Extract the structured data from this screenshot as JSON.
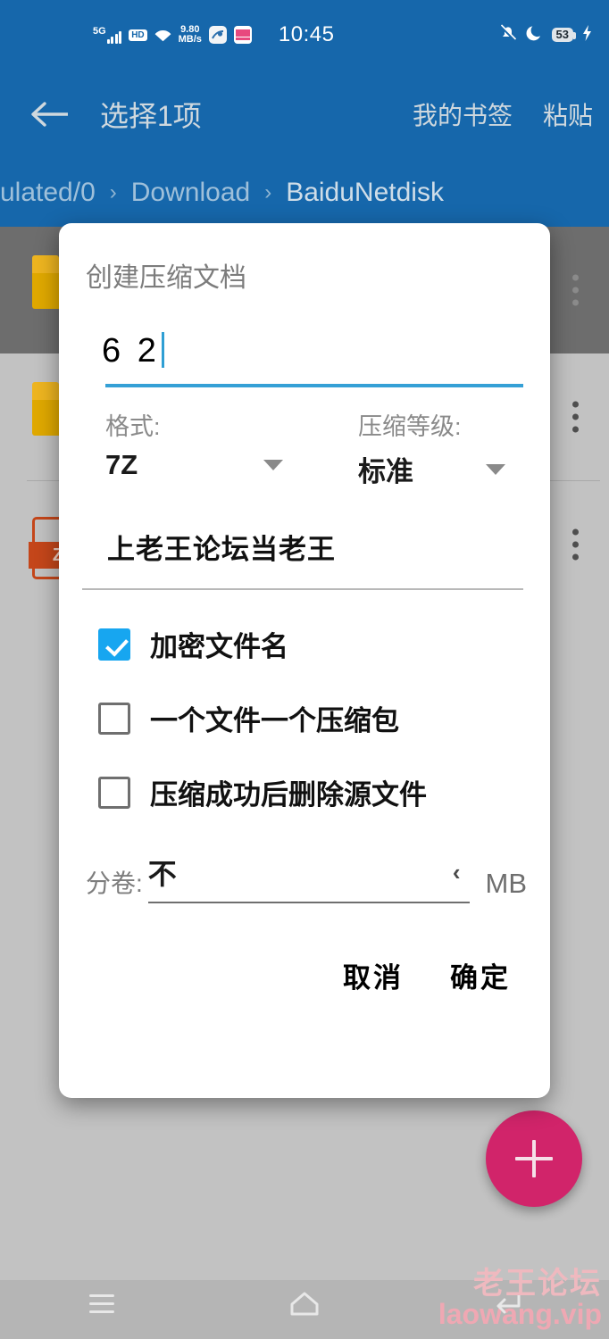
{
  "statusbar": {
    "network_type": "5G",
    "hd_label": "HD",
    "speed_value": "9.80",
    "speed_unit": "MB/s",
    "time": "10:45",
    "battery_level": "53",
    "icons": [
      "signal-icon",
      "hd-icon",
      "wifi-icon",
      "network-speed",
      "app-icon-1",
      "app-icon-2",
      "mute-icon",
      "dnd-moon-icon",
      "battery-icon",
      "charging-bolt-icon"
    ]
  },
  "appbar": {
    "back_icon": "back-arrow-icon",
    "title": "选择1项",
    "action_bookmarks": "我的书签",
    "action_paste": "粘贴"
  },
  "breadcrumb": {
    "items": [
      "ulated/0",
      "Download",
      "BaiduNetdisk"
    ],
    "separator": "›"
  },
  "filelist": {
    "rows": [
      {
        "icon": "folder-icon",
        "selected": true
      },
      {
        "icon": "folder-icon",
        "selected": false
      },
      {
        "icon": "zip-file-icon",
        "icon_label": "Z",
        "selected": false
      }
    ]
  },
  "dialog": {
    "title": "创建压缩文档",
    "name_value": "6 2",
    "format_label": "格式:",
    "format_value": "7Z",
    "level_label": "压缩等级:",
    "level_value": "标准",
    "password_value": "上老王论坛当老王",
    "checkboxes": [
      {
        "label": "加密文件名",
        "checked": true
      },
      {
        "label": "一个文件一个压缩包",
        "checked": false
      },
      {
        "label": "压缩成功后删除源文件",
        "checked": false
      }
    ],
    "split_label": "分卷:",
    "split_value": "不",
    "split_chevron": "‹",
    "split_unit": "MB",
    "cancel_label": "取消",
    "confirm_label": "确定"
  },
  "fab": {
    "icon": "plus-icon"
  },
  "watermark": {
    "line1": "老王论坛",
    "line2": "laowang.vip"
  },
  "navbar": {
    "menu_icon": "menu-icon",
    "home_icon": "home-icon",
    "back_icon": "back-nav-icon"
  },
  "colors": {
    "appbar_blue": "#1667ab",
    "accent_blue": "#35a0d6",
    "checkbox_blue": "#17a6f0",
    "fab_pink": "#d1246a",
    "folder_orange": "#e0a900",
    "zip_red": "#c4461a",
    "watermark_pink": "#efb9bf"
  }
}
